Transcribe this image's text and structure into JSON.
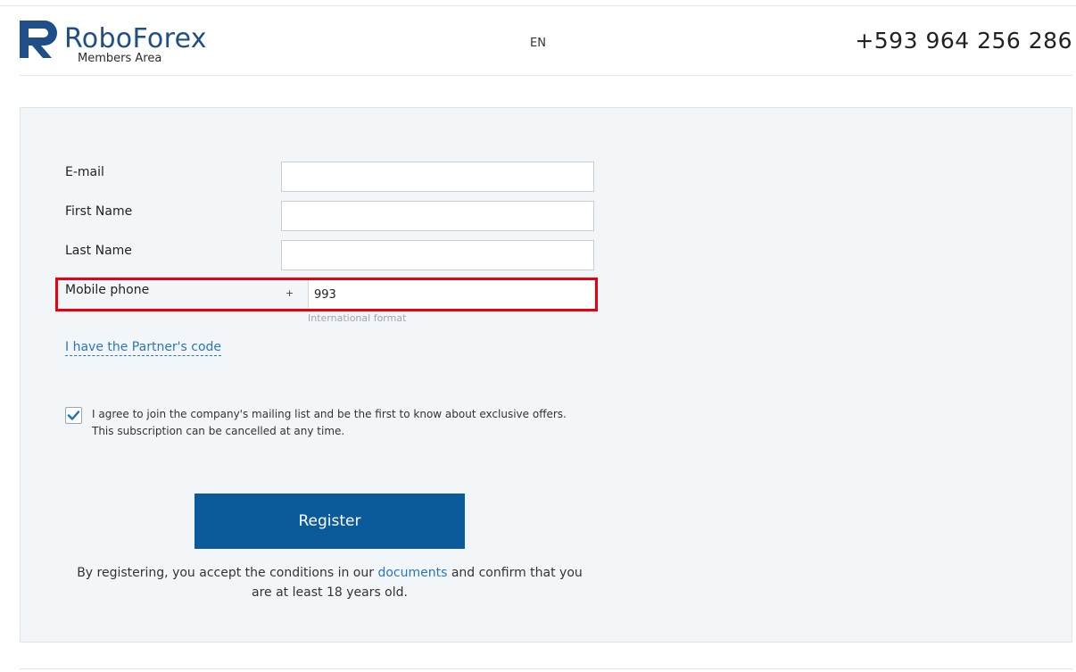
{
  "header": {
    "logo_name": "RoboForex",
    "logo_sub": "Members Area",
    "language": "EN",
    "phone": "+593 964 256 286"
  },
  "form": {
    "email_label": "E-mail",
    "email_value": "",
    "first_name_label": "First Name",
    "first_name_value": "",
    "last_name_label": "Last Name",
    "last_name_value": "",
    "mobile_label": "Mobile phone",
    "mobile_prefix": "+",
    "mobile_value": "993",
    "mobile_hint": "International format",
    "partner_link": "I have the Partner's code",
    "agree_text": "I agree to join the company's mailing list and be the first to know about exclusive offers. This subscription can be cancelled at any time.",
    "agree_checked": true,
    "register_label": "Register",
    "terms_prefix": "By registering, you accept the conditions in our ",
    "terms_link": "documents",
    "terms_suffix": " and confirm that you are at least 18 years old."
  },
  "colors": {
    "brand": "#1f4f86",
    "button": "#0a5a9c",
    "link": "#2a76b8",
    "highlight": "#e8000d"
  }
}
